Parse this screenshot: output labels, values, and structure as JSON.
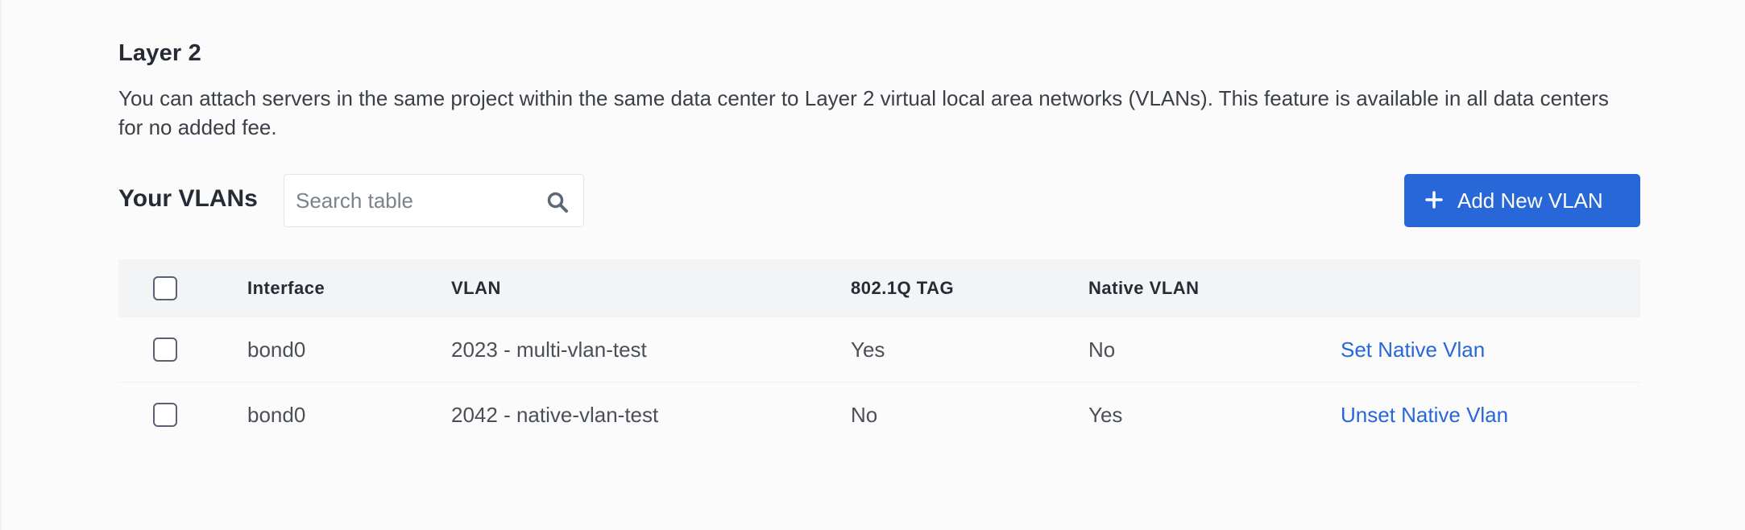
{
  "section": {
    "title": "Layer 2",
    "description": "You can attach servers in the same project within the same data center to Layer 2 virtual local area networks (VLANs). This feature is available in all data centers for no added fee."
  },
  "toolbar": {
    "title": "Your VLANs",
    "search_placeholder": "Search table",
    "add_button_label": "Add New VLAN"
  },
  "table": {
    "columns": [
      "Interface",
      "VLAN",
      "802.1Q TAG",
      "Native VLAN",
      ""
    ],
    "rows": [
      {
        "interface": "bond0",
        "vlan": "2023 - multi-vlan-test",
        "tag": "Yes",
        "native": "No",
        "action": "Set Native Vlan"
      },
      {
        "interface": "bond0",
        "vlan": "2042 - native-vlan-test",
        "tag": "No",
        "native": "Yes",
        "action": "Unset Native Vlan"
      }
    ]
  },
  "colors": {
    "accent": "#2767d8",
    "heading": "#262b35",
    "text": "#3a3f48"
  },
  "icons": {
    "search": "search-icon",
    "add": "plus-icon",
    "checkbox": "checkbox"
  }
}
